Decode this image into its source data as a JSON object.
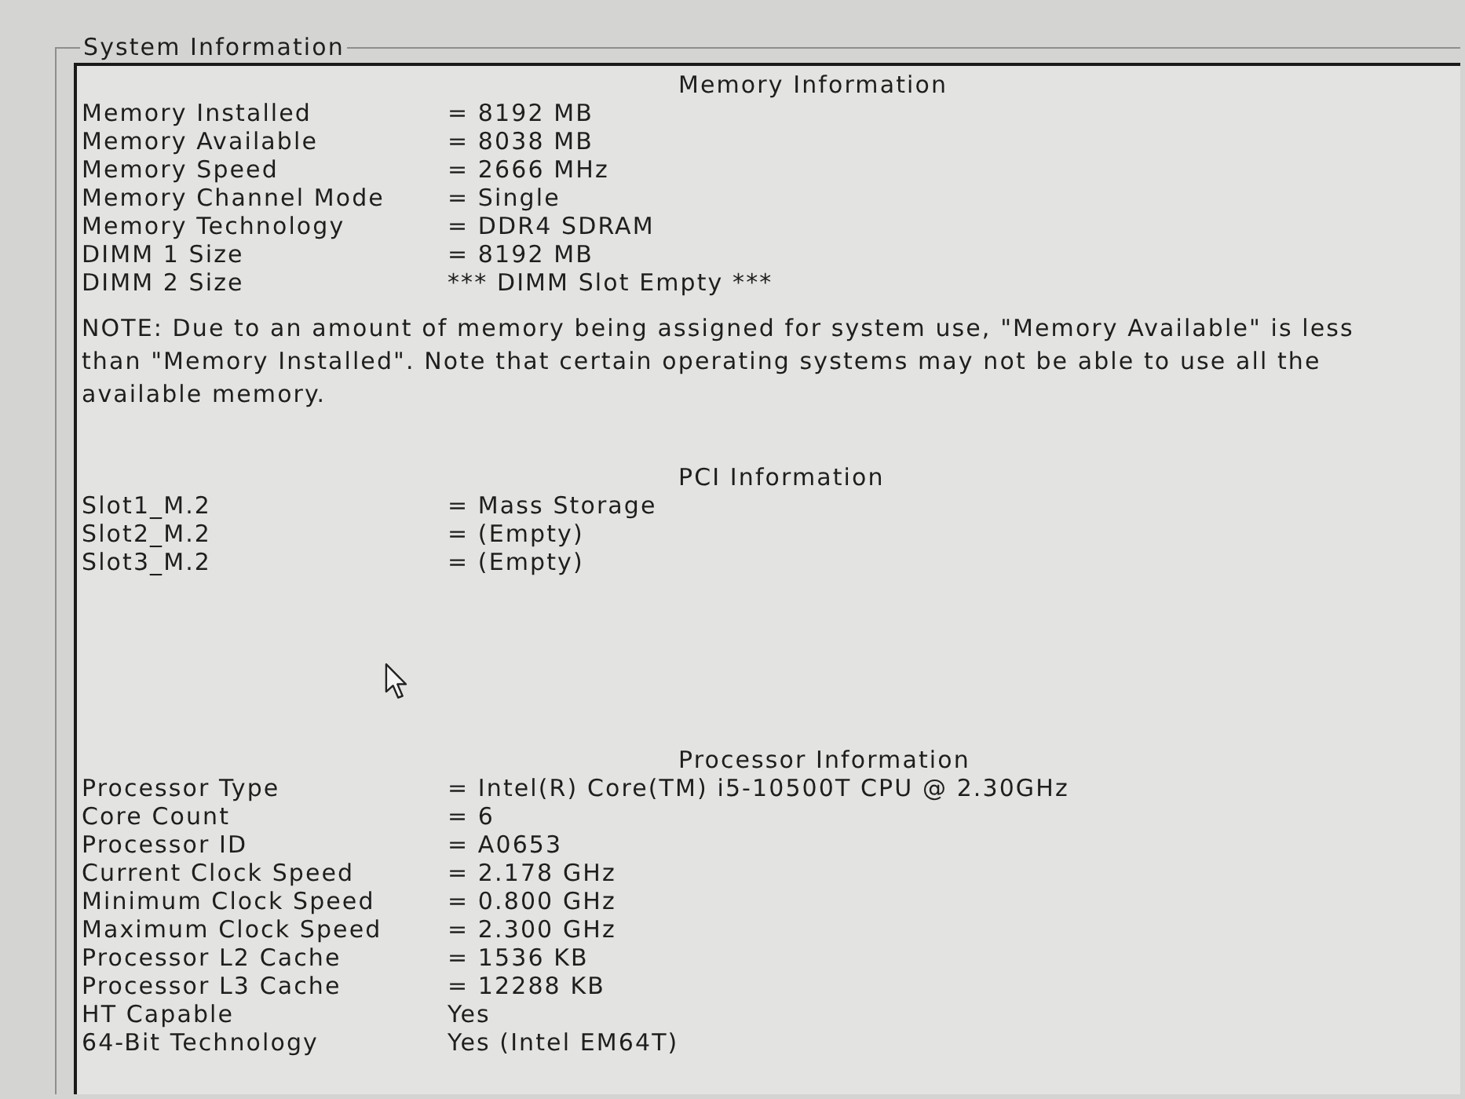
{
  "group_box": {
    "title": "System Information"
  },
  "sections": [
    {
      "heading": "Memory Information",
      "rows": [
        {
          "label": "Memory Installed",
          "value": "= 8192 MB"
        },
        {
          "label": "Memory Available",
          "value": "= 8038 MB"
        },
        {
          "label": "Memory Speed",
          "value": "= 2666 MHz"
        },
        {
          "label": "Memory Channel Mode",
          "value": "= Single"
        },
        {
          "label": "Memory Technology",
          "value": "= DDR4 SDRAM"
        },
        {
          "label": "DIMM 1 Size",
          "value": "= 8192 MB"
        },
        {
          "label": "DIMM 2 Size",
          "value": "*** DIMM Slot Empty ***"
        }
      ],
      "note": "NOTE: Due to an amount of memory being assigned for system use, \"Memory Available\" is less than \"Memory Installed\". Note that certain operating systems may not be able to use all the available memory."
    },
    {
      "heading": "PCI Information",
      "rows": [
        {
          "label": "Slot1_M.2",
          "value": "= Mass Storage"
        },
        {
          "label": "Slot2_M.2",
          "value": "= (Empty)"
        },
        {
          "label": "Slot3_M.2",
          "value": "= (Empty)"
        }
      ]
    },
    {
      "heading": "Processor Information",
      "rows": [
        {
          "label": "Processor Type",
          "value": "= Intel(R) Core(TM) i5-10500T CPU @ 2.30GHz"
        },
        {
          "label": "Core Count",
          "value": "= 6"
        },
        {
          "label": "Processor ID",
          "value": "= A0653"
        },
        {
          "label": "Current Clock Speed",
          "value": "= 2.178 GHz"
        },
        {
          "label": "Minimum Clock Speed",
          "value": "= 0.800 GHz"
        },
        {
          "label": "Maximum Clock Speed",
          "value": "= 2.300 GHz"
        },
        {
          "label": "Processor L2 Cache",
          "value": "= 1536 KB"
        },
        {
          "label": "Processor L3 Cache",
          "value": "= 12288 KB"
        },
        {
          "label": "HT Capable",
          "value": "Yes"
        },
        {
          "label": "64-Bit Technology",
          "value": "Yes (Intel EM64T)"
        }
      ]
    }
  ]
}
